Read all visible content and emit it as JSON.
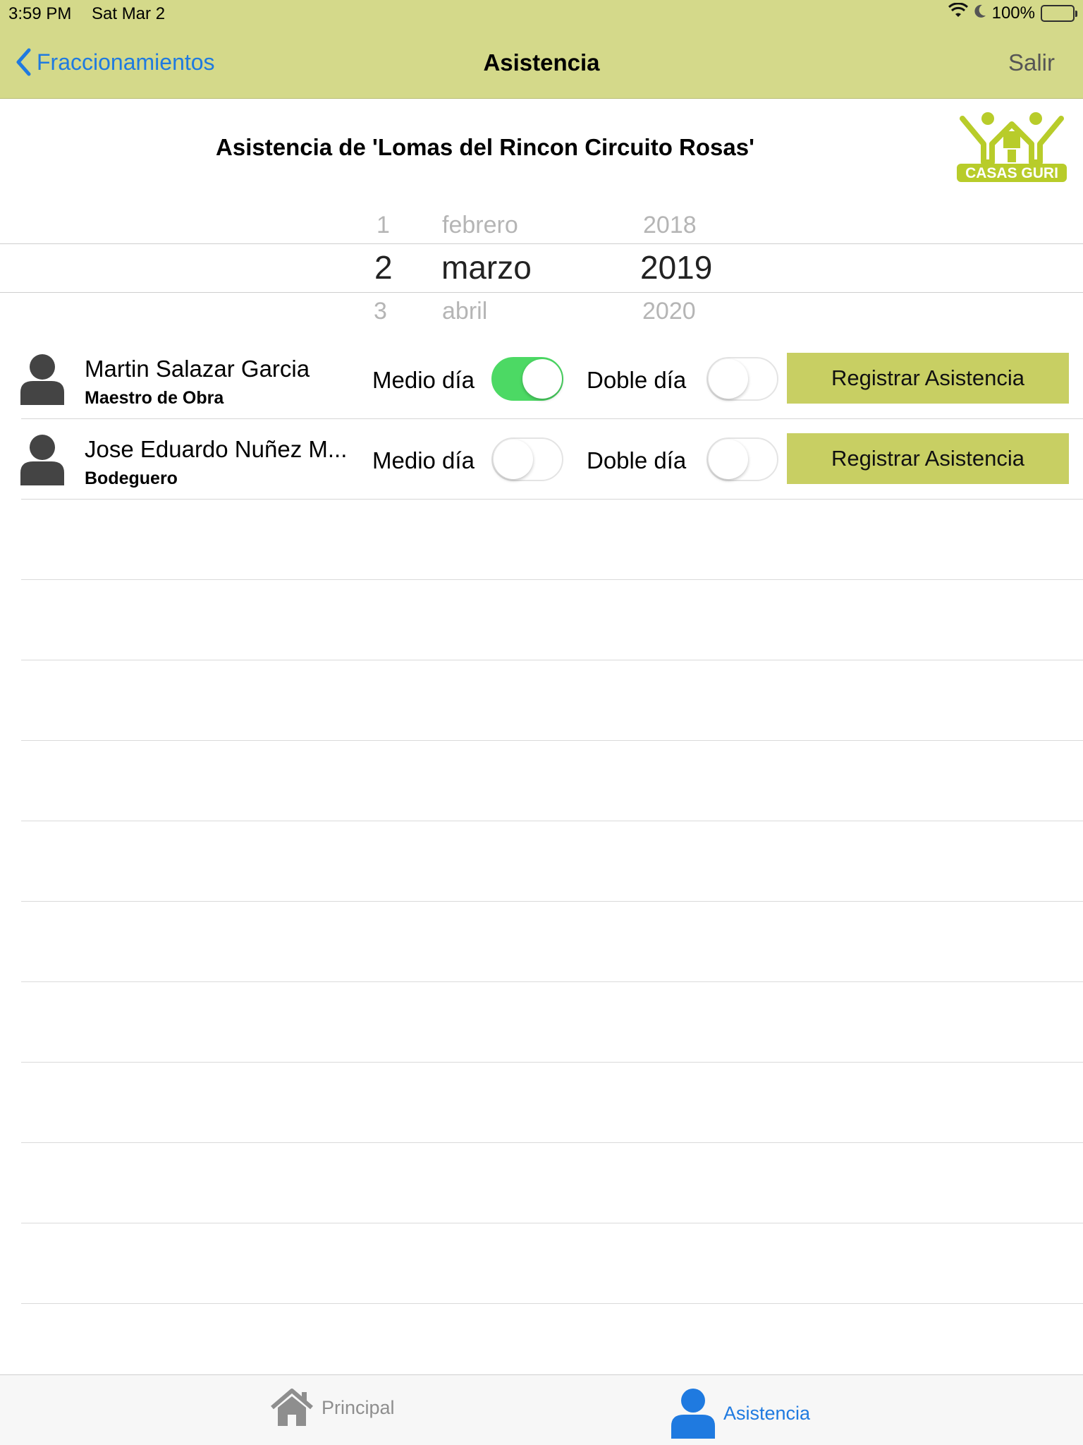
{
  "status_bar": {
    "time": "3:59 PM",
    "date": "Sat Mar 2",
    "battery": "100%"
  },
  "nav": {
    "back_label": "Fraccionamientos",
    "title": "Asistencia",
    "right_label": "Salir"
  },
  "header": {
    "title": "Asistencia de 'Lomas del Rincon Circuito Rosas'",
    "logo_text": "CASAS GURI"
  },
  "date_picker": {
    "day": {
      "prev": "1",
      "selected": "2",
      "next": "3"
    },
    "month": {
      "prev": "febrero",
      "selected": "marzo",
      "next": "abril"
    },
    "year": {
      "prev": "2018",
      "selected": "2019",
      "next": "2020"
    }
  },
  "employees": [
    {
      "name": "Martin Salazar Garcia",
      "role": "Maestro de Obra",
      "half_day_label": "Medio día",
      "half_day_on": true,
      "double_day_label": "Doble día",
      "double_day_on": false,
      "button_label": "Registrar Asistencia"
    },
    {
      "name": "Jose Eduardo Nuñez M...",
      "role": "Bodeguero",
      "half_day_label": "Medio día",
      "half_day_on": false,
      "double_day_label": "Doble día",
      "double_day_on": false,
      "button_label": "Registrar Asistencia"
    }
  ],
  "tabbar": {
    "tabs": [
      {
        "label": "Principal",
        "icon": "house-icon",
        "active": false
      },
      {
        "label": "Asistencia",
        "icon": "person-icon",
        "active": true
      }
    ]
  },
  "colors": {
    "bar": "#d4d98a",
    "accent": "#1f7ae0",
    "button": "#c8cf63",
    "switch_on": "#4cd964",
    "logo": "#b8cc2a"
  }
}
